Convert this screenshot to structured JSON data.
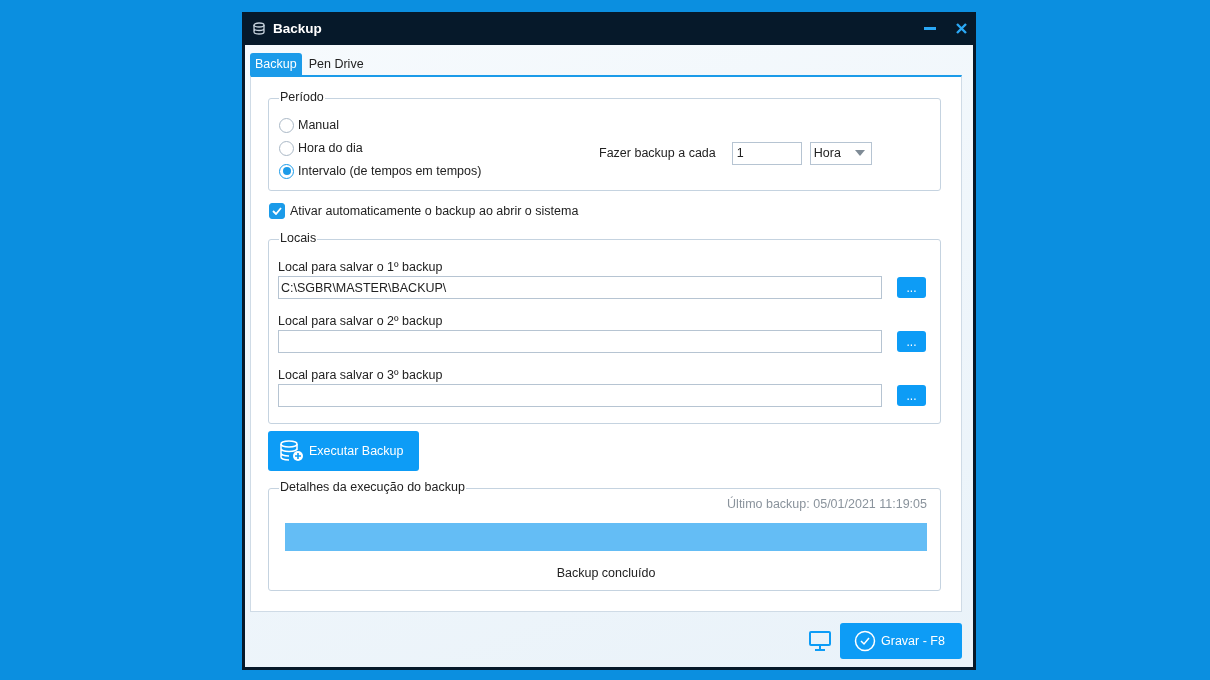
{
  "window": {
    "title": "Backup"
  },
  "tabs": [
    {
      "label": "Backup",
      "selected": true
    },
    {
      "label": "Pen Drive",
      "selected": false
    }
  ],
  "periodo": {
    "title": "Período",
    "options": [
      {
        "label": "Manual",
        "selected": false
      },
      {
        "label": "Hora do dia",
        "selected": false
      },
      {
        "label": "Intervalo (de tempos em tempos)",
        "selected": true
      }
    ],
    "interval_label": "Fazer backup a cada",
    "interval_value": "1",
    "unit": "Hora"
  },
  "auto_start": {
    "label": "Ativar automaticamente o backup ao abrir o sistema",
    "checked": true
  },
  "locais": {
    "title": "Locais",
    "paths": [
      {
        "label": "Local para salvar o 1º backup",
        "value": "C:\\SGBR\\MASTER\\BACKUP\\",
        "browse": "..."
      },
      {
        "label": "Local para salvar o 2º backup",
        "browse": "..."
      },
      {
        "label": "Local para salvar o 3º backup",
        "browse": "..."
      }
    ]
  },
  "execute_button": "Executar Backup",
  "details": {
    "title": "Detalhes da execução do backup",
    "last_backup": "Último backup: 05/01/2021 11:19:05",
    "level": 1,
    "status": "Backup concluído"
  },
  "save_button": "Gravar - F8"
}
